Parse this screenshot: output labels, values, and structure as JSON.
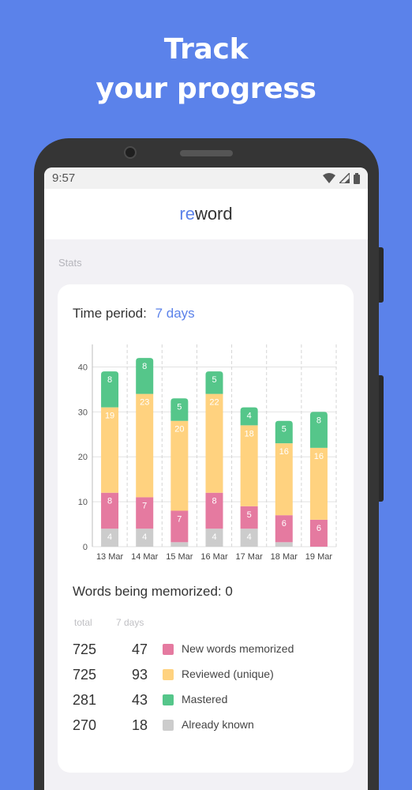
{
  "promo": {
    "line1": "Track",
    "line2": "your progress"
  },
  "status_bar": {
    "time": "9:57"
  },
  "app_bar": {
    "logo_re": "re",
    "logo_word": "word"
  },
  "stats": {
    "section_label": "Stats",
    "time_period_label": "Time period:",
    "time_period_value": "7 days",
    "words_memorizing_label": "Words being memorized: 0",
    "col_total": "total",
    "col_week": "7 days",
    "legend": [
      {
        "total": "725",
        "week": "47",
        "label": "New words memorized",
        "color": "#e57aa0"
      },
      {
        "total": "725",
        "week": "93",
        "label": "Reviewed (unique)",
        "color": "#ffd27f"
      },
      {
        "total": "281",
        "week": "43",
        "label": "Mastered",
        "color": "#55c68a"
      },
      {
        "total": "270",
        "week": "18",
        "label": "Already known",
        "color": "#cccccc"
      }
    ]
  },
  "chart_data": {
    "type": "bar",
    "stacked": true,
    "categories": [
      "13 Mar",
      "14 Mar",
      "15 Mar",
      "16 Mar",
      "17 Mar",
      "18 Mar",
      "19 Mar"
    ],
    "ylim": [
      0,
      45
    ],
    "yticks": [
      0,
      10,
      20,
      30,
      40
    ],
    "series": [
      {
        "color": "#cccccc",
        "values": [
          4,
          4,
          1,
          4,
          4,
          1,
          0
        ]
      },
      {
        "color": "#e57aa0",
        "values": [
          8,
          7,
          7,
          8,
          5,
          6,
          6
        ]
      },
      {
        "color": "#ffd27f",
        "values": [
          19,
          23,
          20,
          22,
          18,
          16,
          16
        ]
      },
      {
        "color": "#55c68a",
        "values": [
          8,
          8,
          5,
          5,
          4,
          5,
          8
        ]
      }
    ],
    "hidden_labels": [
      [
        false,
        false,
        false,
        false,
        false,
        false,
        true
      ]
    ],
    "label_colors": [
      "#ffffff",
      "#ffffff",
      "#ffffff",
      "#ffffff"
    ]
  }
}
